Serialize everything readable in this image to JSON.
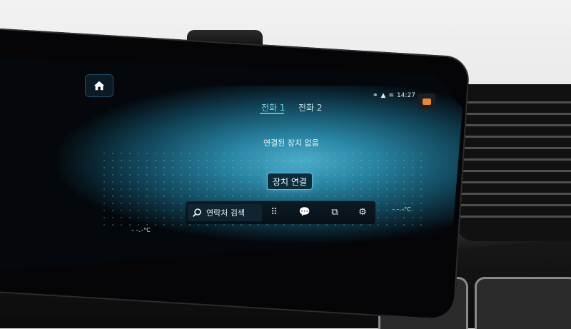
{
  "header": {
    "tabs": [
      {
        "label": "전화 1",
        "active": true
      },
      {
        "label": "전화 2",
        "active": false
      }
    ]
  },
  "status_bar": {
    "time": "14:27"
  },
  "main": {
    "message": "연결된 장치 없음",
    "connect_button_label": "장치 연결"
  },
  "bottom_bar": {
    "search_label": "연락처 검색"
  },
  "climate": {
    "left_temp": "– –.–°C",
    "right_temp": "– –.–°C"
  },
  "colors": {
    "accent": "#73d2f0",
    "notification": "#e28a36",
    "glow": "#4fb6d4"
  },
  "icons": [
    "home-icon",
    "message-icon",
    "search-icon",
    "keypad-icon",
    "chat-icon",
    "phone-copy-icon",
    "settings-icon"
  ]
}
